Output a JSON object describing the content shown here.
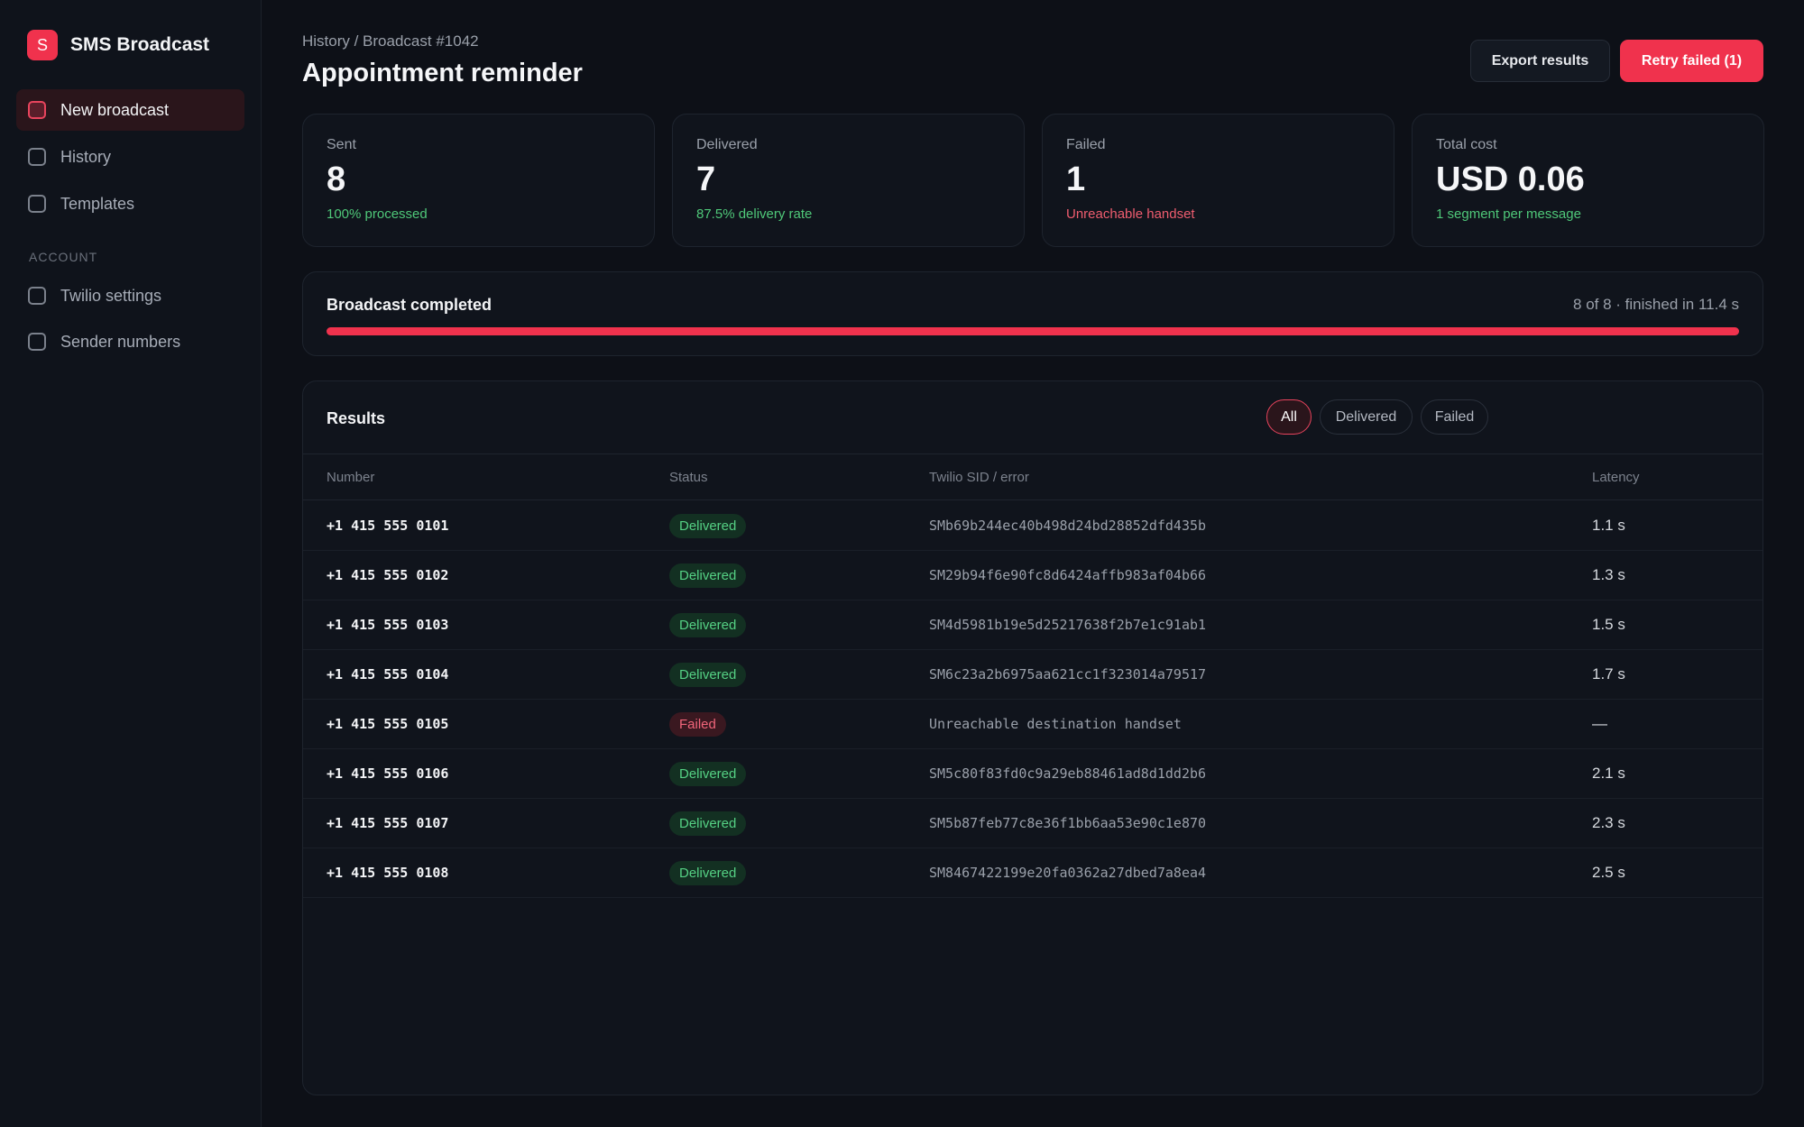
{
  "app": {
    "logo_letter": "S",
    "name": "SMS Broadcast"
  },
  "sidebar": {
    "items": [
      {
        "label": "New broadcast"
      },
      {
        "label": "History"
      },
      {
        "label": "Templates"
      }
    ],
    "section_label": "ACCOUNT",
    "account_items": [
      {
        "label": "Twilio settings"
      },
      {
        "label": "Sender numbers"
      }
    ]
  },
  "header": {
    "breadcrumb": "History / Broadcast #1042",
    "title": "Appointment reminder",
    "export_label": "Export results",
    "retry_label": "Retry failed (1)"
  },
  "stats": [
    {
      "label": "Sent",
      "value": "8",
      "sub": "100% processed"
    },
    {
      "label": "Delivered",
      "value": "7",
      "sub": "87.5% delivery rate"
    },
    {
      "label": "Failed",
      "value": "1",
      "sub": "Unreachable handset"
    },
    {
      "label": "Total cost",
      "value": "USD 0.06",
      "sub": "1 segment per message"
    }
  ],
  "progress": {
    "title": "Broadcast completed",
    "meta": "8 of 8 · finished in 11.4 s",
    "fraction": 1.0
  },
  "results": {
    "title": "Results",
    "filters": [
      "All",
      "Delivered",
      "Failed"
    ],
    "columns": [
      "Number",
      "Status",
      "Twilio SID / error",
      "Latency"
    ],
    "rows": [
      {
        "number": "+1 415 555 0101",
        "status": "Delivered",
        "sid": "SMb69b244ec40b498d24bd28852dfd435b",
        "latency": "1.1 s"
      },
      {
        "number": "+1 415 555 0102",
        "status": "Delivered",
        "sid": "SM29b94f6e90fc8d6424affb983af04b66",
        "latency": "1.3 s"
      },
      {
        "number": "+1 415 555 0103",
        "status": "Delivered",
        "sid": "SM4d5981b19e5d25217638f2b7e1c91ab1",
        "latency": "1.5 s"
      },
      {
        "number": "+1 415 555 0104",
        "status": "Delivered",
        "sid": "SM6c23a2b6975aa621cc1f323014a79517",
        "latency": "1.7 s"
      },
      {
        "number": "+1 415 555 0105",
        "status": "Failed",
        "sid": "Unreachable destination handset",
        "latency": "—"
      },
      {
        "number": "+1 415 555 0106",
        "status": "Delivered",
        "sid": "SM5c80f83fd0c9a29eb88461ad8d1dd2b6",
        "latency": "2.1 s"
      },
      {
        "number": "+1 415 555 0107",
        "status": "Delivered",
        "sid": "SM5b87feb77c8e36f1bb6aa53e90c1e870",
        "latency": "2.3 s"
      },
      {
        "number": "+1 415 555 0108",
        "status": "Delivered",
        "sid": "SM8467422199e20fa0362a27dbed7a8ea4",
        "latency": "2.5 s"
      }
    ]
  }
}
